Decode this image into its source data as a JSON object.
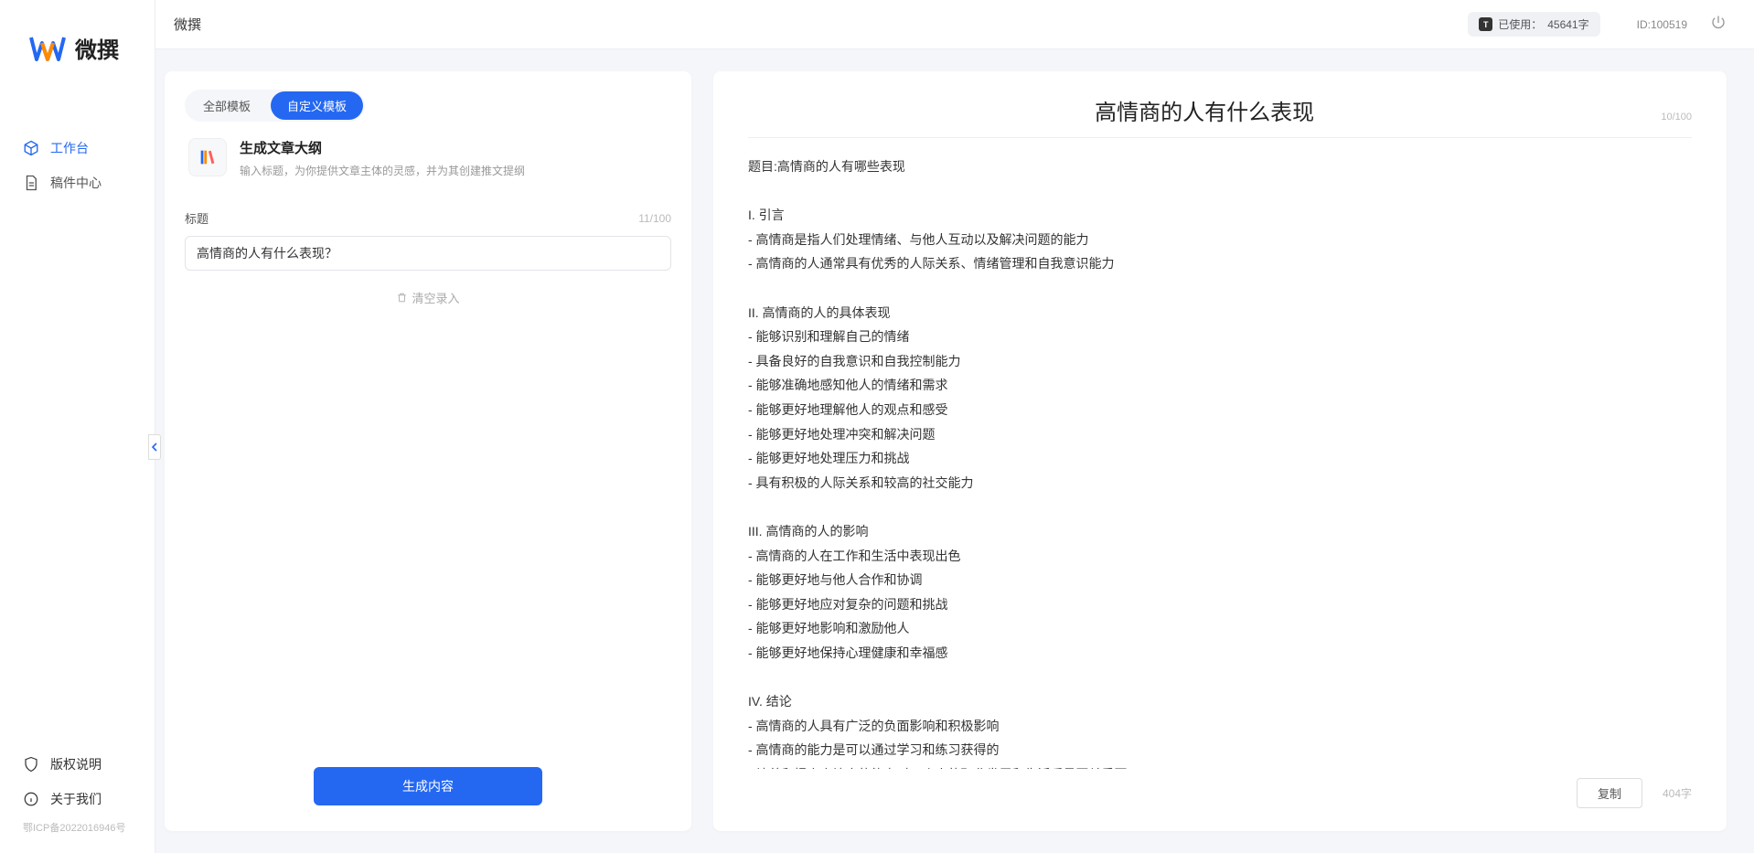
{
  "brand": {
    "name": "微撰"
  },
  "sidebar": {
    "nav": [
      {
        "label": "工作台",
        "active": true,
        "icon": "cube"
      },
      {
        "label": "稿件中心",
        "active": false,
        "icon": "doc"
      }
    ],
    "footer": [
      {
        "label": "版权说明",
        "icon": "shield"
      },
      {
        "label": "关于我们",
        "icon": "info"
      }
    ],
    "icp": "鄂ICP备2022016946号"
  },
  "topbar": {
    "title": "微撰",
    "usage_label": "已使用：",
    "usage_value": "45641字",
    "user_id_label": "ID:",
    "user_id": "100519"
  },
  "left": {
    "tabs": [
      {
        "label": "全部模板",
        "active": false
      },
      {
        "label": "自定义模板",
        "active": true
      }
    ],
    "template": {
      "title": "生成文章大纲",
      "desc": "输入标题，为你提供文章主体的灵感，并为其创建推文提纲"
    },
    "field": {
      "label": "标题",
      "counter": "11/100",
      "value": "高情商的人有什么表现？"
    },
    "clear_label": "清空录入",
    "generate_label": "生成内容"
  },
  "right": {
    "title": "高情商的人有什么表现",
    "header_stat": "10/100",
    "body": "题目:高情商的人有哪些表现\n\nI. 引言\n- 高情商是指人们处理情绪、与他人互动以及解决问题的能力\n- 高情商的人通常具有优秀的人际关系、情绪管理和自我意识能力\n\nII. 高情商的人的具体表现\n- 能够识别和理解自己的情绪\n- 具备良好的自我意识和自我控制能力\n- 能够准确地感知他人的情绪和需求\n- 能够更好地理解他人的观点和感受\n- 能够更好地处理冲突和解决问题\n- 能够更好地处理压力和挑战\n- 具有积极的人际关系和较高的社交能力\n\nIII. 高情商的人的影响\n- 高情商的人在工作和生活中表现出色\n- 能够更好地与他人合作和协调\n- 能够更好地应对复杂的问题和挑战\n- 能够更好地影响和激励他人\n- 能够更好地保持心理健康和幸福感\n\nIV. 结论\n- 高情商的人具有广泛的负面影响和积极影响\n- 高情商的能力是可以通过学习和练习获得的\n- 培养和提高高情商的能力对于个人的职业发展和生活质量至关重要。",
    "copy_label": "复制",
    "word_count": "404字"
  }
}
